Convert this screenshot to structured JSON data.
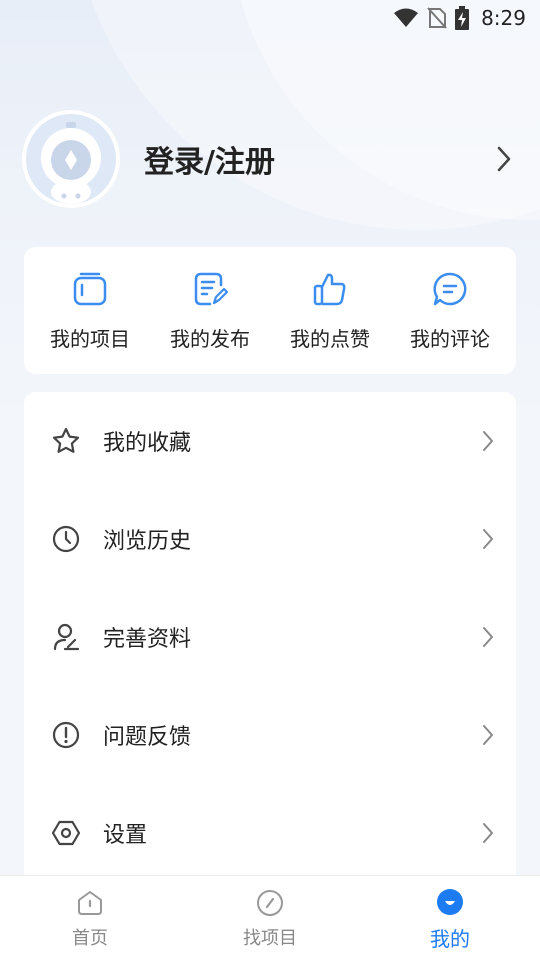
{
  "status_bar": {
    "time": "8:29"
  },
  "profile": {
    "login_label": "登录/注册"
  },
  "quick_actions": [
    {
      "label": "我的项目",
      "icon": "projects-icon"
    },
    {
      "label": "我的发布",
      "icon": "publish-icon"
    },
    {
      "label": "我的点赞",
      "icon": "thumbs-up-icon"
    },
    {
      "label": "我的评论",
      "icon": "comment-icon"
    }
  ],
  "menu": [
    {
      "label": "我的收藏",
      "icon": "star-icon"
    },
    {
      "label": "浏览历史",
      "icon": "clock-icon"
    },
    {
      "label": "完善资料",
      "icon": "edit-profile-icon"
    },
    {
      "label": "问题反馈",
      "icon": "feedback-icon"
    },
    {
      "label": "设置",
      "icon": "settings-icon"
    }
  ],
  "bottom_nav": [
    {
      "label": "首页",
      "icon": "home-icon",
      "active": false
    },
    {
      "label": "找项目",
      "icon": "compass-icon",
      "active": false
    },
    {
      "label": "我的",
      "icon": "profile-icon",
      "active": true
    }
  ],
  "colors": {
    "accent": "#1e7cf2",
    "icon_blue": "#3b8ef0",
    "text": "#222222",
    "muted": "#888888"
  }
}
